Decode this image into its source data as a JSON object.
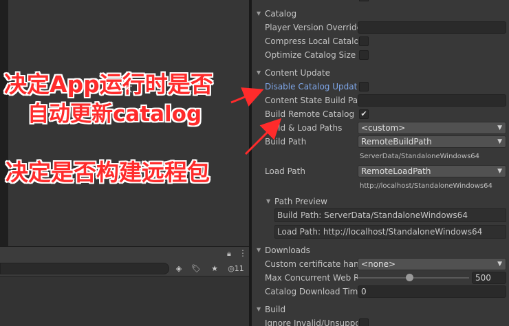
{
  "inspector": {
    "catalog": {
      "header": "Catalog",
      "player_version_override": "Player Version Override",
      "compress_local_catalog": "Compress Local Catalog",
      "optimize_catalog_size": "Optimize Catalog Size"
    },
    "content_update": {
      "header": "Content Update",
      "disable_catalog_update": "Disable Catalog Update",
      "content_state_build_path": "Content State Build Path",
      "build_remote_catalog": "Build Remote Catalog",
      "build_remote_catalog_checked": true,
      "build_load_paths": "Build & Load Paths",
      "build_load_paths_value": "<custom>",
      "build_path": "Build Path",
      "build_path_value": "RemoteBuildPath",
      "build_path_hint": "ServerData/StandaloneWindows64",
      "load_path": "Load Path",
      "load_path_value": "RemoteLoadPath",
      "load_path_hint": "http://localhost/StandaloneWindows64",
      "path_preview": "Path Preview",
      "build_path_preview": "Build Path: ServerData/StandaloneWindows64",
      "load_path_preview": "Load Path: http://localhost/StandaloneWindows64"
    },
    "downloads": {
      "header": "Downloads",
      "custom_certificate_handler": "Custom certificate handler",
      "custom_certificate_handler_value": "<none>",
      "max_concurrent_web_requests": "Max Concurrent Web Requests",
      "max_concurrent_web_requests_value": "500",
      "max_concurrent_web_requests_level": 0.46,
      "catalog_download_timeout": "Catalog Download Timeout",
      "catalog_download_timeout_value": "0"
    },
    "build": {
      "header": "Build",
      "ignore_invalid": "Ignore Invalid/Unsupported Files"
    }
  },
  "project": {
    "hidden_count": "11"
  },
  "annotations": {
    "line1": "决定App运行时是否",
    "line2": "自动更新catalog",
    "line3": "决定是否构建远程包"
  },
  "icons": {
    "lock": "lock-icon",
    "more": "more-icon",
    "tag": "tag-icon",
    "star": "star-icon",
    "eye": "eye-slash-icon"
  },
  "colors": {
    "annotation": "#ff2b2b",
    "label_highlight": "#7ea6e8",
    "inspector_bg": "#383838"
  }
}
